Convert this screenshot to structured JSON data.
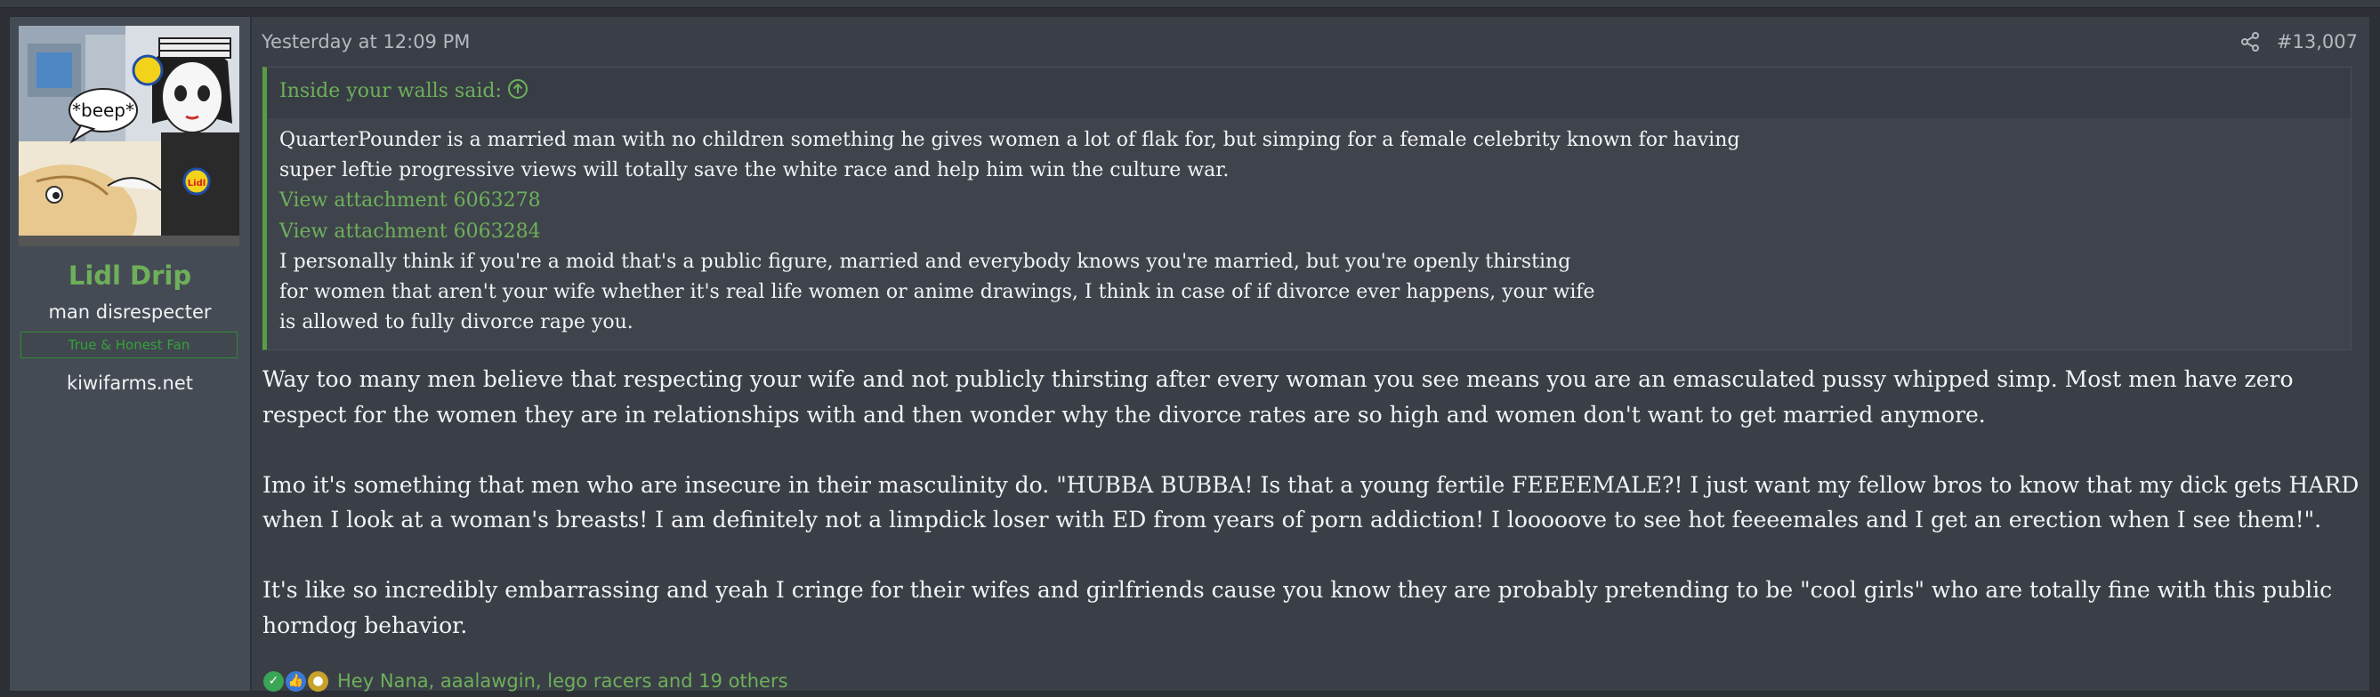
{
  "post": {
    "date": "Yesterday at 12:09 PM",
    "number": "#13,007",
    "share_icon": "share-icon"
  },
  "user": {
    "name": "Lidl Drip",
    "title": "man disrespecter",
    "banner": "True & Honest Fan",
    "site": "kiwifarms.net",
    "avatar_text": "*beep*",
    "avatar_logo_text": "Lidl"
  },
  "quote": {
    "author": "Inside your walls said:",
    "lines": [
      "QuarterPounder is a married man with no children something he gives women a lot of flak for, but simping for a female celebrity known for having",
      "super leftie progressive views will totally save the white race and help him win the culture war.",
      "View attachment 6063278",
      "View attachment 6063284",
      "I personally think if you're a moid that's a public figure, married and everybody knows you're married, but you're openly thirsting",
      "for women that aren't your wife whether it's real life women or anime drawings, I think in case of if divorce ever happens, your wife",
      "is allowed to fully divorce rape you."
    ]
  },
  "message": {
    "paragraphs": [
      [
        "Way too many men believe that respecting your wife and not publicly thirsting after every woman you see means you are an emasculated pussy whipped simp. Most men have zero",
        "respect for the women they are in relationships with and then wonder why the divorce rates are so high and women don't want to get married anymore."
      ],
      [
        "Imo it's something that men who are insecure in their masculinity do. \"HUBBA BUBBA! Is that a young fertile FEEEEMALE?! I just want my fellow bros to know that my dick gets HARD",
        "when I look at a woman's breasts! I am definitely not a limpdick loser with ED from years of porn addiction! I looooove to see hot feeeemales and I get an erection when I see them!\"."
      ],
      [
        "It's like so incredibly embarrassing and yeah I cringe for their wifes and girlfriends cause you know they are probably pretending to be \"cool girls\" who are totally fine with this public",
        "horndog behavior."
      ]
    ]
  },
  "reactions": {
    "icons": [
      "check-reaction-icon",
      "thumbs-up-reaction-icon",
      "medal-reaction-icon"
    ],
    "names": "Hey Nana, aaalawgin, lego racers and 19 others"
  },
  "colors": {
    "accent_green": "#6eb05a",
    "background": "#3a3f47",
    "sidebar": "#454b54"
  }
}
